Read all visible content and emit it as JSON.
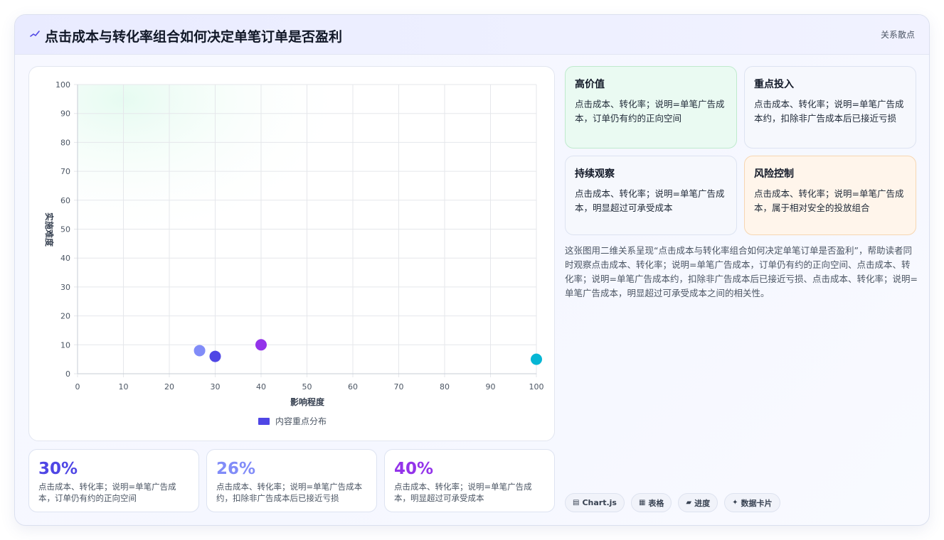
{
  "header": {
    "title": "点击成本与转化率组合如何决定单笔订单是否盈利",
    "tag": "关系散点"
  },
  "chart_data": {
    "type": "scatter",
    "xlabel": "影响程度",
    "ylabel": "实施难度",
    "xlim": [
      0,
      100
    ],
    "ylim": [
      0,
      100
    ],
    "x_ticks": [
      0,
      10,
      20,
      30,
      40,
      50,
      60,
      70,
      80,
      90,
      100
    ],
    "y_ticks": [
      0,
      10,
      20,
      30,
      40,
      50,
      60,
      70,
      80,
      90,
      100
    ],
    "grid": true,
    "legend_position": "bottom",
    "series": [
      {
        "name": "内容重点分布",
        "legend_color": "#4f46e5",
        "points": [
          {
            "x": 30,
            "y": 6,
            "color": "#4f46e5"
          },
          {
            "x": 26.6,
            "y": 8,
            "color": "#818cf8"
          },
          {
            "x": 40,
            "y": 10,
            "color": "#9333ea"
          },
          {
            "x": 100,
            "y": 5,
            "color": "#06b6d4"
          }
        ]
      }
    ]
  },
  "quadrants": [
    {
      "title": "高价值",
      "desc": "点击成本、转化率；说明=单笔广告成本，订单仍有约的正向空间"
    },
    {
      "title": "重点投入",
      "desc": "点击成本、转化率；说明=单笔广告成本约，扣除非广告成本后已接近亏损"
    },
    {
      "title": "持续观察",
      "desc": "点击成本、转化率；说明=单笔广告成本，明显超过可承受成本"
    },
    {
      "title": "风险控制",
      "desc": "点击成本、转化率；说明=单笔广告成本，属于相对安全的投放组合"
    }
  ],
  "summary": "这张图用二维关系呈现“点击成本与转化率组合如何决定单笔订单是否盈利”，帮助读者同时观察点击成本、转化率；说明=单笔广告成本，订单仍有约的正向空间、点击成本、转化率；说明=单笔广告成本约，扣除非广告成本后已接近亏损、点击成本、转化率；说明=单笔广告成本，明显超过可承受成本之间的相关性。",
  "stats": [
    {
      "value": "30%",
      "desc": "点击成本、转化率；说明=单笔广告成本，订单仍有约的正向空间"
    },
    {
      "value": "26%",
      "desc": "点击成本、转化率；说明=单笔广告成本约，扣除非广告成本后已接近亏损"
    },
    {
      "value": "40%",
      "desc": "点击成本、转化率；说明=单笔广告成本，明显超过可承受成本"
    }
  ],
  "chips": [
    {
      "icon": "▤",
      "label": "Chart.js"
    },
    {
      "icon": "▦",
      "label": "表格"
    },
    {
      "icon": "▰",
      "label": "进度"
    },
    {
      "icon": "✦",
      "label": "数据卡片"
    }
  ],
  "colors": {
    "accent": "#4f46e5",
    "grid": "#e5e7eb"
  }
}
